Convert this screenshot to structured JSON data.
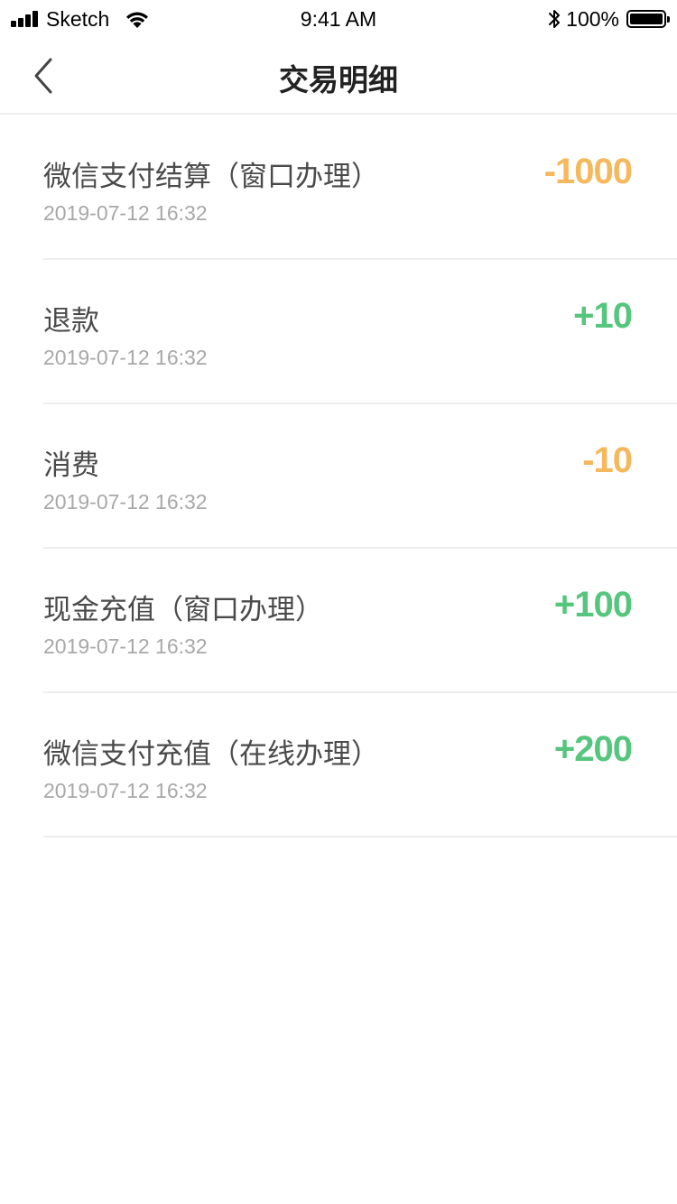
{
  "status_bar": {
    "carrier": "Sketch",
    "time": "9:41 AM",
    "battery_percent": "100%",
    "battery_level": 1.0,
    "icons": [
      "signal-icon",
      "wifi-icon",
      "bluetooth-icon",
      "battery-icon"
    ]
  },
  "nav": {
    "title": "交易明细",
    "back_icon": "chevron-left-icon"
  },
  "colors": {
    "negative_amount": "#f6b85c",
    "positive_amount": "#56c57d",
    "title_text": "#4a4a4a",
    "time_text": "#a8a8a8",
    "divider": "#eeeeee"
  },
  "transactions": [
    {
      "title": "微信支付结算（窗口办理）",
      "time": "2019-07-12 16:32",
      "amount": "-1000",
      "direction": "negative"
    },
    {
      "title": "退款",
      "time": "2019-07-12 16:32",
      "amount": "+10",
      "direction": "positive"
    },
    {
      "title": "消费",
      "time": "2019-07-12 16:32",
      "amount": "-10",
      "direction": "negative"
    },
    {
      "title": "现金充值（窗口办理）",
      "time": "2019-07-12 16:32",
      "amount": "+100",
      "direction": "positive"
    },
    {
      "title": "微信支付充值（在线办理）",
      "time": "2019-07-12 16:32",
      "amount": "+200",
      "direction": "positive"
    }
  ]
}
